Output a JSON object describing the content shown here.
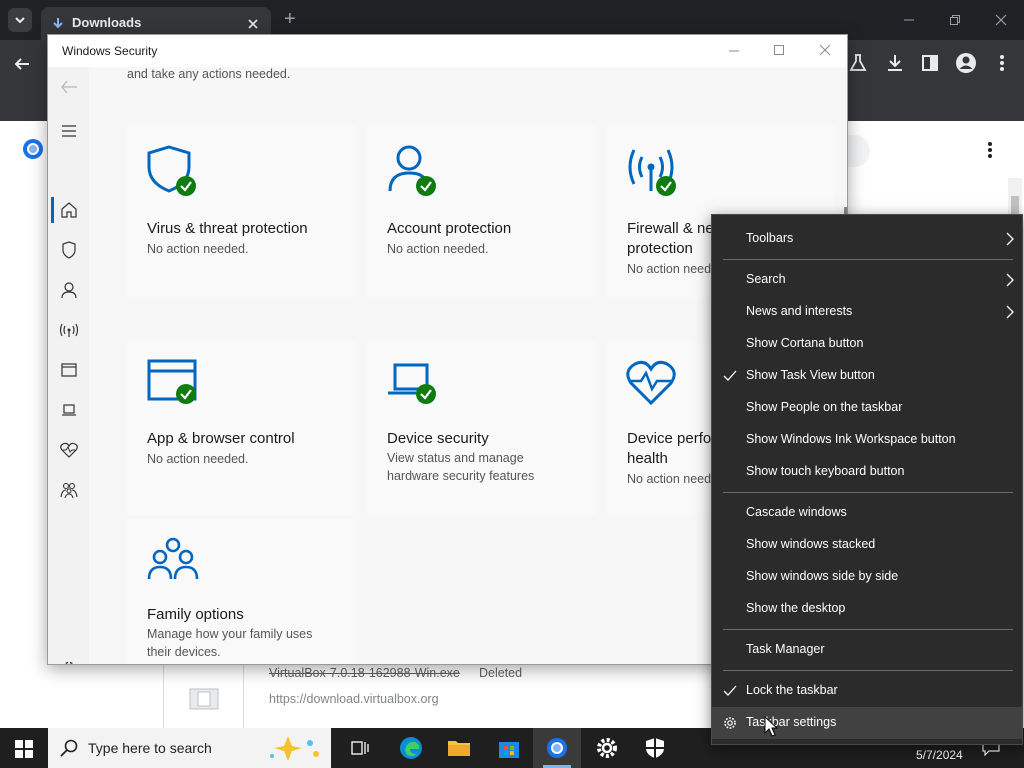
{
  "browser": {
    "tab_title": "Downloads",
    "new_tab": "+",
    "download_item": {
      "filename": "VirtualBox-7.0.18-162988-Win.exe",
      "status": "Deleted",
      "url": "https://download.virtualbox.org"
    }
  },
  "security_window": {
    "title": "Windows Security",
    "intro_text": "and take any actions needed.",
    "tiles": [
      {
        "title": "Virus & threat protection",
        "desc": "No action needed.",
        "icon": "shield-icon"
      },
      {
        "title": "Account protection",
        "desc": "No action needed.",
        "icon": "person-icon"
      },
      {
        "title": "Firewall & network protection",
        "title_line1": "Firewall & ne",
        "title_line2": "protection",
        "desc": "No action need",
        "icon": "antenna-icon"
      },
      {
        "title": "App & browser control",
        "desc": "No action needed.",
        "icon": "browser-window-icon"
      },
      {
        "title": "Device security",
        "desc_line1": "View status and manage",
        "desc_line2": "hardware security features",
        "icon": "laptop-icon"
      },
      {
        "title_line1": "Device perfo",
        "title_line2": "health",
        "desc": "No action need",
        "icon": "heart-icon"
      },
      {
        "title": "Family options",
        "desc_line1": "Manage how your family uses",
        "desc_line2": "their devices.",
        "icon": "family-icon"
      }
    ]
  },
  "context_menu": {
    "items": [
      {
        "label": "Toolbars",
        "submenu": true
      },
      {
        "label": "Search",
        "submenu": true
      },
      {
        "label": "News and interests",
        "submenu": true
      },
      {
        "label": "Show Cortana button"
      },
      {
        "label": "Show Task View button",
        "checked": true
      },
      {
        "label": "Show People on the taskbar"
      },
      {
        "label": "Show Windows Ink Workspace button"
      },
      {
        "label": "Show touch keyboard button"
      },
      {
        "label": "Cascade windows"
      },
      {
        "label": "Show windows stacked"
      },
      {
        "label": "Show windows side by side"
      },
      {
        "label": "Show the desktop"
      },
      {
        "label": "Task Manager"
      },
      {
        "label": "Lock the taskbar",
        "checked": true
      },
      {
        "label": "Taskbar settings",
        "hovered": true
      }
    ]
  },
  "taskbar": {
    "search_placeholder": "Type here to search",
    "date": "5/7/2024"
  },
  "colors": {
    "accent_blue": "#0067c0",
    "check_green": "#107c10",
    "menu_bg": "#2b2b2b",
    "taskbar_bg": "#1f1f1f"
  }
}
